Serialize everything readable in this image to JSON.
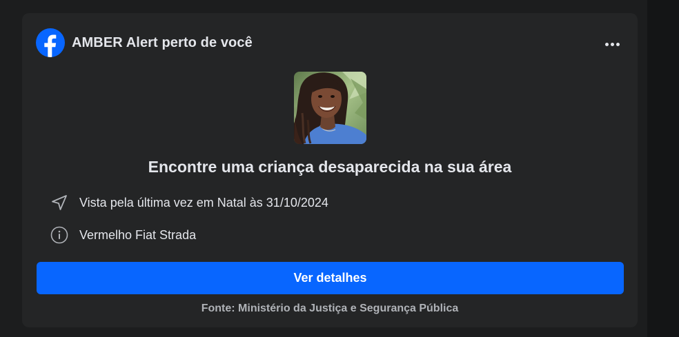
{
  "alert": {
    "title": "AMBER Alert perto de você",
    "headline": "Encontre uma criança desaparecida na sua área",
    "last_seen": "Vista pela última vez em Natal às 31/10/2024",
    "vehicle": "Vermelho Fiat Strada",
    "cta_label": "Ver detalhes",
    "source": "Fonte: Ministério da Justiça e Segurança Pública"
  },
  "icons": {
    "logo": "facebook-logo",
    "more": "more-horizontal-icon",
    "location": "navigation-arrow-icon",
    "info": "info-circle-icon"
  },
  "colors": {
    "background": "#18191a",
    "card": "#242526",
    "accent": "#0866ff",
    "text_primary": "#e4e6eb",
    "text_secondary": "#b0b3b8"
  }
}
